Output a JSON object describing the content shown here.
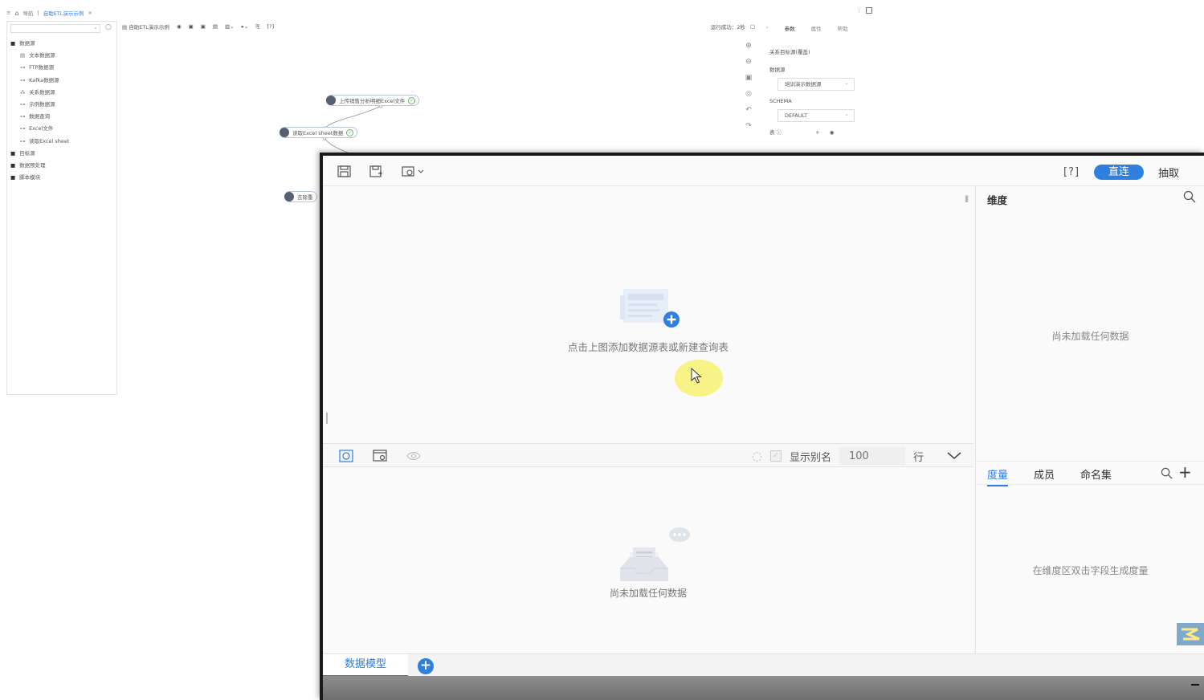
{
  "background_window": {
    "breadcrumb": {
      "home": "导航",
      "active_tab": "自助ETL演示示例",
      "close": "×"
    },
    "tree": [
      {
        "icon": "folder-icon",
        "label": "数据源",
        "child": false
      },
      {
        "icon": "text-file-icon",
        "label": "文本数据源",
        "child": true
      },
      {
        "icon": "link-icon",
        "label": "FTP数据源",
        "child": true
      },
      {
        "icon": "link-icon",
        "label": "Kafka数据源",
        "child": true
      },
      {
        "icon": "relation-icon",
        "label": "关系数据源",
        "child": true
      },
      {
        "icon": "link-icon",
        "label": "示例数据源",
        "child": true
      },
      {
        "icon": "link-icon",
        "label": "数据查询",
        "child": true
      },
      {
        "icon": "link-icon",
        "label": "Excel文件",
        "child": true
      },
      {
        "icon": "link-icon",
        "label": "读取Excel sheet",
        "child": true
      },
      {
        "icon": "folder-icon",
        "label": "目标源",
        "child": false
      },
      {
        "icon": "folder-icon",
        "label": "数据预处理",
        "child": false
      },
      {
        "icon": "folder-icon",
        "label": "脚本模块",
        "child": false
      }
    ],
    "toolbar_title": "自助ETL演示示例",
    "toolbar_help": "[?]",
    "run_status": "运行成功：2秒",
    "nodes": [
      {
        "label": "上传销售分析明细Excel文件"
      },
      {
        "label": "读取Excel sheet数据"
      },
      {
        "label": "去除重"
      }
    ],
    "right_tabs": [
      "参数",
      "属性",
      "帮助"
    ],
    "props": {
      "title": "关系目标源(覆盖)",
      "datasource_label": "数据源",
      "datasource_value": "培训演示数据源",
      "schema_label": "SCHEMA",
      "schema_value": "DEFAULT",
      "table_label": "表"
    }
  },
  "dialog": {
    "toolbar": {
      "help": "[?]",
      "mode_direct": "直连",
      "mode_extract": "抽取"
    },
    "canvas": {
      "empty_hint": "点击上图添加数据源表或新建查询表"
    },
    "preview_bar": {
      "show_alias_label": "显示别名",
      "row_count_placeholder": "100",
      "rows_unit": "行"
    },
    "preview": {
      "empty_text": "尚未加载任何数据"
    },
    "dimension_panel": {
      "title": "维度",
      "empty_text": "尚未加载任何数据"
    },
    "measure_panel": {
      "tabs": [
        "度量",
        "成员",
        "命名集"
      ],
      "add": "+",
      "empty_text": "在维度区双击字段生成度量"
    },
    "bottom_tabs": {
      "model": "数据模型",
      "add": "+"
    }
  },
  "colors": {
    "accent": "#2f7fe0",
    "success": "#5db85d",
    "cursor_highlight": "#f7f27a"
  }
}
